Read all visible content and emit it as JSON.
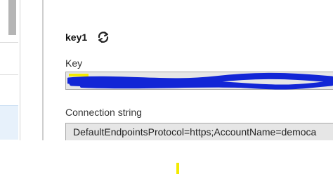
{
  "key": {
    "title": "key1",
    "refresh_icon": "refresh-icon",
    "key_label": "Key",
    "key_value": "",
    "connection_label": "Connection string",
    "connection_value": "DefaultEndpointsProtocol=https;AccountName=democa"
  },
  "colors": {
    "field_background": "#e6e6e6",
    "field_border": "#a8a8a8",
    "redaction_blue": "#1226d6",
    "redaction_yellow": "#f3ea00",
    "selected_row": "#e7f1fb"
  }
}
